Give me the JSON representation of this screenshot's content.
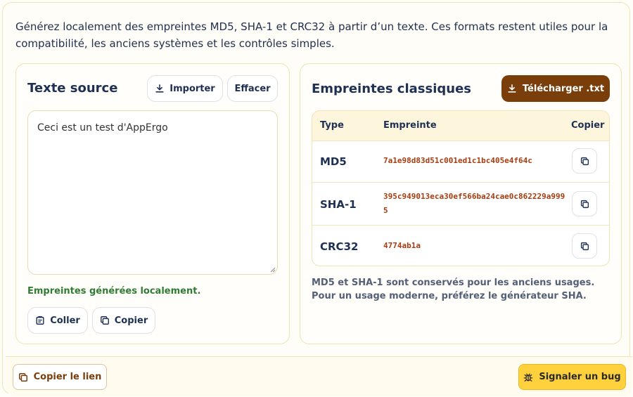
{
  "intro": "Générez localement des empreintes MD5, SHA-1 et CRC32 à partir d’un texte. Ces formats restent utiles pour la compatibilité, les anciens systèmes et les contrôles simples.",
  "source": {
    "title": "Texte source",
    "import_label": "Importer",
    "clear_label": "Effacer",
    "text_value": "Ceci est un test d'AppErgo",
    "status": "Empreintes générées localement.",
    "paste_label": "Coller",
    "copy_label": "Copier"
  },
  "hashes": {
    "title": "Empreintes classiques",
    "download_label": "Télécharger .txt",
    "columns": {
      "type": "Type",
      "hash": "Empreinte",
      "copy": "Copier"
    },
    "rows": [
      {
        "type": "MD5",
        "hash": "7a1e98d83d51c001ed1c1bc405e4f64c"
      },
      {
        "type": "SHA-1",
        "hash": "395c949013eca30ef566ba24cae0c862229a9995"
      },
      {
        "type": "CRC32",
        "hash": "4774ab1a"
      }
    ],
    "note": "MD5 et SHA-1 sont conservés pour les anciens usages. Pour un usage moderne, préférez le générateur SHA."
  },
  "footer": {
    "copy_link_label": "Copier le lien",
    "report_bug_label": "Signaler un bug"
  },
  "colors": {
    "accent_brown": "#7a3e0b",
    "accent_yellow": "#ffd23d",
    "success_green": "#2f7d32",
    "hash_red": "#a63c10"
  },
  "icons": {
    "import": "download-icon",
    "download": "download-icon",
    "paste": "clipboard-icon",
    "copy": "copy-icon",
    "bug": "bug-icon"
  }
}
